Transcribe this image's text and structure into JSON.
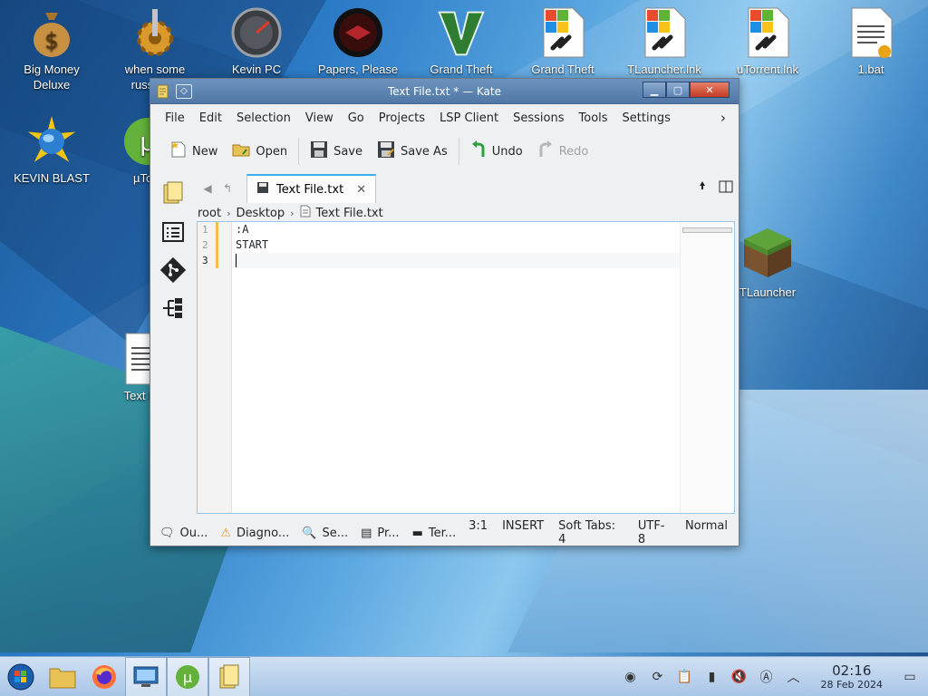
{
  "desktop": {
    "icons": [
      {
        "label": "Big Money\nDeluxe"
      },
      {
        "label": "when some\nrussian..."
      },
      {
        "label": "Kevin PC\nOptimizer Ho..."
      },
      {
        "label": "Papers, Please\n"
      },
      {
        "label": "Grand Theft\n...[7L]"
      },
      {
        "label": "Grand Theft\nAuto V [7L].lnk"
      },
      {
        "label": "TLauncher.lnk\n"
      },
      {
        "label": "uTorrent.lnk\n"
      },
      {
        "label": "1.bat\n"
      },
      {
        "label": "KEVIN BLAST"
      },
      {
        "label": "µTo..."
      },
      {
        "label": "Text F..."
      },
      {
        "label": "TLauncher"
      }
    ]
  },
  "window": {
    "title": "Text File.txt * — Kate",
    "menu_btn": "◇",
    "controls": {
      "minimize": "▁",
      "maximize": "▢",
      "close": "✕"
    }
  },
  "menubar": {
    "items": [
      "File",
      "Edit",
      "Selection",
      "View",
      "Go",
      "Projects",
      "LSP Client",
      "Sessions",
      "Tools",
      "Settings"
    ],
    "more": "›"
  },
  "toolbar": {
    "new": "New",
    "open": "Open",
    "save": "Save",
    "save_as": "Save As",
    "undo": "Undo",
    "redo": "Redo"
  },
  "tab": {
    "label": "Text File.txt",
    "close": "✕"
  },
  "breadcrumb": {
    "items": [
      "root",
      "Desktop",
      "Text File.txt"
    ]
  },
  "editor": {
    "line_numbers": [
      "1",
      "2",
      "3"
    ],
    "lines": [
      ":A",
      "START",
      ""
    ]
  },
  "statusbar": {
    "output": "Ou...",
    "diagnostics": "Diagno...",
    "search": "Se...",
    "projects": "Pr...",
    "terminal": "Ter...",
    "position": "3:1",
    "mode": "INSERT",
    "indent": "Soft Tabs: 4",
    "encoding": "UTF-8",
    "syntax": "Normal"
  },
  "taskbar": {
    "time": "02:16",
    "date": "28 Feb 2024"
  },
  "colors": {
    "accent": "#3daee9",
    "titlebar": "#5f84b3",
    "close": "#c23b22",
    "modified_marker": "#f2c14e"
  }
}
